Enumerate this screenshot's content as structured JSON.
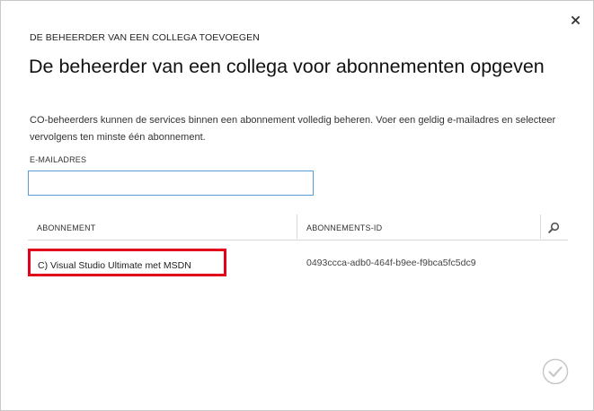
{
  "dialog": {
    "eyebrow": "DE BEHEERDER VAN EEN COLLEGA TOEVOEGEN",
    "title": "De beheerder van een collega voor abonnementen opgeven",
    "description": "CO-beheerders kunnen de services binnen een abonnement volledig beheren. Voer een geldig e-mailadres en selecteer vervolgens ten minste één abonnement.",
    "close_icon": "close-icon",
    "confirm_icon": "checkmark-icon",
    "colors": {
      "highlight": "#e3001b",
      "input_border": "#5b9bd5",
      "confirm_disabled": "#c8c8c8"
    }
  },
  "email": {
    "label": "E-MAILADRES",
    "value": "",
    "placeholder": ""
  },
  "table": {
    "columns": [
      "ABONNEMENT",
      "ABONNEMENTS-ID"
    ],
    "search_icon": "search-icon",
    "rows": [
      {
        "name": "C) Visual Studio Ultimate met MSDN",
        "id": "0493ccca-adb0-464f-b9ee-f9bca5fc5dc9"
      }
    ]
  }
}
